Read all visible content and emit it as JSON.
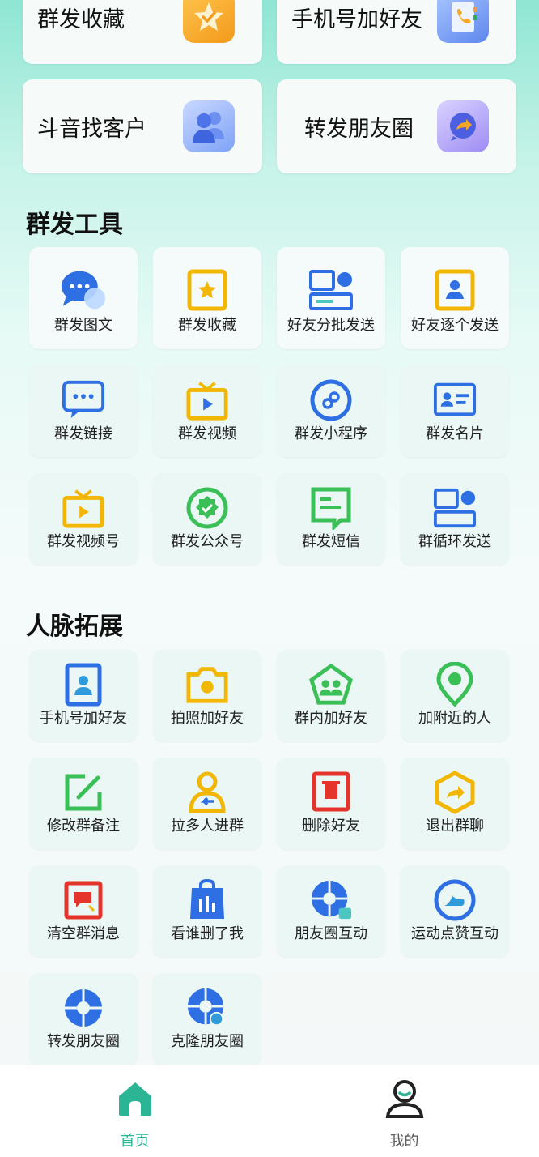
{
  "featured": [
    {
      "label": "群发收藏",
      "icon": "star-folder-icon"
    },
    {
      "label": "手机号加好友",
      "icon": "phonebook-icon"
    },
    {
      "label": "斗音找客户",
      "icon": "users-icon"
    },
    {
      "label": "转发朋友圈",
      "icon": "forward-chat-icon"
    }
  ],
  "sections": {
    "mass_tools": {
      "title": "群发工具",
      "items": [
        {
          "label": "群发图文",
          "icon": "chat-bubbles-icon"
        },
        {
          "label": "群发收藏",
          "icon": "star-card-icon"
        },
        {
          "label": "好友分批发送",
          "icon": "batch-layout-icon"
        },
        {
          "label": "好友逐个发送",
          "icon": "person-card-icon"
        },
        {
          "label": "群发链接",
          "icon": "message-dots-icon"
        },
        {
          "label": "群发视频",
          "icon": "tv-play-icon"
        },
        {
          "label": "群发小程序",
          "icon": "mini-program-icon"
        },
        {
          "label": "群发名片",
          "icon": "business-card-icon"
        },
        {
          "label": "群发视频号",
          "icon": "video-channel-icon"
        },
        {
          "label": "群发公众号",
          "icon": "official-badge-icon"
        },
        {
          "label": "群发短信",
          "icon": "sms-icon"
        },
        {
          "label": "群循环发送",
          "icon": "loop-layout-icon"
        }
      ]
    },
    "network": {
      "title": "人脉拓展",
      "items": [
        {
          "label": "手机号加好友",
          "icon": "phone-contact-icon"
        },
        {
          "label": "拍照加好友",
          "icon": "camera-icon"
        },
        {
          "label": "群内加好友",
          "icon": "group-pentagon-icon"
        },
        {
          "label": "加附近的人",
          "icon": "location-pin-icon"
        },
        {
          "label": "修改群备注",
          "icon": "edit-icon"
        },
        {
          "label": "拉多人进群",
          "icon": "pull-person-icon"
        },
        {
          "label": "删除好友",
          "icon": "trash-icon"
        },
        {
          "label": "退出群聊",
          "icon": "exit-hexagon-icon"
        },
        {
          "label": "清空群消息",
          "icon": "clear-message-icon"
        },
        {
          "label": "看谁删了我",
          "icon": "bag-chart-icon"
        },
        {
          "label": "朋友圈互动",
          "icon": "moments-interact-icon"
        },
        {
          "label": "运动点赞互动",
          "icon": "sport-shoe-icon"
        },
        {
          "label": "转发朋友圈",
          "icon": "moments-icon"
        },
        {
          "label": "克隆朋友圈",
          "icon": "moments-clone-icon"
        }
      ]
    }
  },
  "tabbar": {
    "home_label": "首页",
    "mine_label": "我的",
    "active_color": "#2bb594",
    "inactive_color": "#555555"
  }
}
